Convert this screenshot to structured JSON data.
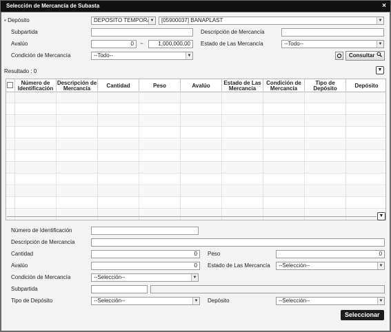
{
  "window": {
    "title": "Selección de Mercancía de Subasta",
    "close": "×"
  },
  "filters": {
    "deposito_label": "Depósito",
    "deposito_type": "DEPOSITO TEMPORAL",
    "deposito_value": "[05900037] BANAPLAST",
    "subpartida_label": "Subpartida",
    "subpartida_value": "",
    "descripcion_label": "Descripción de Mercancía",
    "descripcion_value": "",
    "avaluo_label": "Avalúo",
    "avaluo_from": "0",
    "avaluo_sep": "~",
    "avaluo_to": "1,000,000.00",
    "estado_label": "Estado de Las Mercancía",
    "estado_value": "--Todo--",
    "condicion_label": "Condición de Mercancía",
    "condicion_value": "--Todo--",
    "consultar_label": "Consultar"
  },
  "results": {
    "label": "Resultado : 0",
    "columns": [
      "Número de Identificación",
      "Descripción de Mercancía",
      "Cantidad",
      "Peso",
      "Avalúo",
      "Estado de Las Mercancía",
      "Condición de Mercancía",
      "Tipo de Depósito",
      "Depósito"
    ],
    "rows": []
  },
  "detail": {
    "numero_label": "Número de Identificación",
    "numero_value": "",
    "descripcion_label": "Descripción de Mercancía",
    "descripcion_value": "",
    "cantidad_label": "Cantidad",
    "cantidad_value": "0",
    "peso_label": "Peso",
    "peso_value": "0",
    "avaluo_label": "Avalúo",
    "avaluo_value": "0",
    "estado_label": "Estado de Las Mercancía",
    "estado_value": "--Selección--",
    "condicion_label": "Condición de Mercancía",
    "condicion_value": "--Selección--",
    "subpartida_label": "Subpartida",
    "subpartida_value": "",
    "subpartida_desc": "",
    "tipo_label": "Tipo de Depósito",
    "tipo_value": "--Selección--",
    "deposito_label": "Depósito",
    "deposito_value": "--Selección--"
  },
  "actions": {
    "seleccionar_label": "Seleccionar"
  },
  "icons": {
    "required_mark": "▪",
    "dropdown": "▼",
    "reset": "refresh-icon",
    "search": "search-icon",
    "collapse": "chevron-down-icon"
  },
  "colors": {
    "titlebar": "#111111",
    "primary_button": "#1d1d1d",
    "panel": "#f3f3f3"
  }
}
